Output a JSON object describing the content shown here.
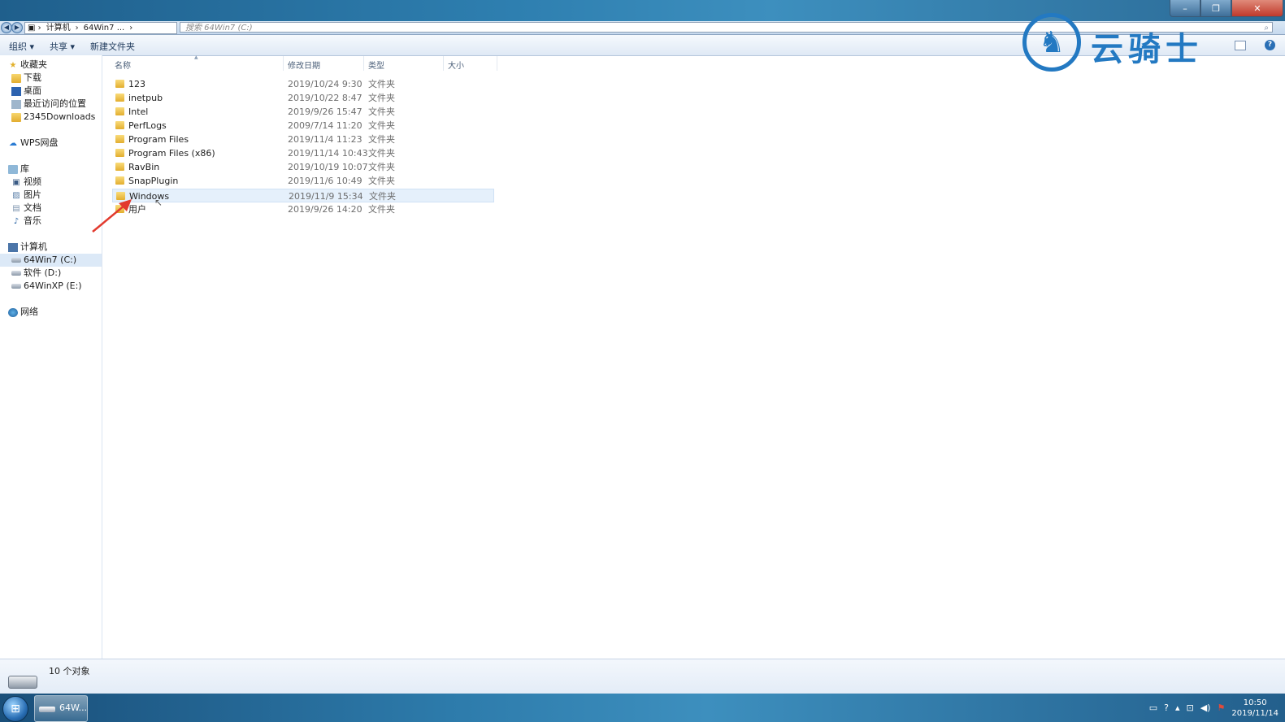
{
  "window": {
    "controls": {
      "minimize": "–",
      "maximize": "❐",
      "close": "✕"
    }
  },
  "address": {
    "crumbs": [
      "计算机",
      "64Win7 ..."
    ],
    "search_placeholder": "搜索 64Win7  (C:)"
  },
  "toolbar": {
    "organize": "组织 ▾",
    "share": "共享 ▾",
    "new_folder": "新建文件夹"
  },
  "logo": {
    "text": "云骑士"
  },
  "sidebar": {
    "favorites": "收藏夹",
    "downloads": "下载",
    "desktop": "桌面",
    "recent": "最近访问的位置",
    "downloads2345": "2345Downloads",
    "wps": "WPS网盘",
    "library": "库",
    "videos": "视频",
    "pictures": "图片",
    "documents": "文档",
    "music": "音乐",
    "computer": "计算机",
    "drive_c": "64Win7  (C:)",
    "drive_d": "软件 (D:)",
    "drive_e": "64WinXP  (E:)",
    "network": "网络"
  },
  "columns": {
    "name": "名称",
    "date": "修改日期",
    "type": "类型",
    "size": "大小"
  },
  "files": [
    {
      "name": "123",
      "date": "2019/10/24 9:30",
      "type": "文件夹"
    },
    {
      "name": "inetpub",
      "date": "2019/10/22 8:47",
      "type": "文件夹"
    },
    {
      "name": "Intel",
      "date": "2019/9/26 15:47",
      "type": "文件夹"
    },
    {
      "name": "PerfLogs",
      "date": "2009/7/14 11:20",
      "type": "文件夹"
    },
    {
      "name": "Program Files",
      "date": "2019/11/4 11:23",
      "type": "文件夹"
    },
    {
      "name": "Program Files (x86)",
      "date": "2019/11/14 10:43",
      "type": "文件夹"
    },
    {
      "name": "RavBin",
      "date": "2019/10/19 10:07",
      "type": "文件夹"
    },
    {
      "name": "SnapPlugin",
      "date": "2019/11/6 10:49",
      "type": "文件夹"
    },
    {
      "name": "Windows",
      "date": "2019/11/9 15:34",
      "type": "文件夹"
    },
    {
      "name": "用户",
      "date": "2019/9/26 14:20",
      "type": "文件夹"
    }
  ],
  "status": {
    "count": "10 个对象"
  },
  "taskbar": {
    "task_label": "64W...",
    "time": "10:50",
    "date": "2019/11/14"
  }
}
